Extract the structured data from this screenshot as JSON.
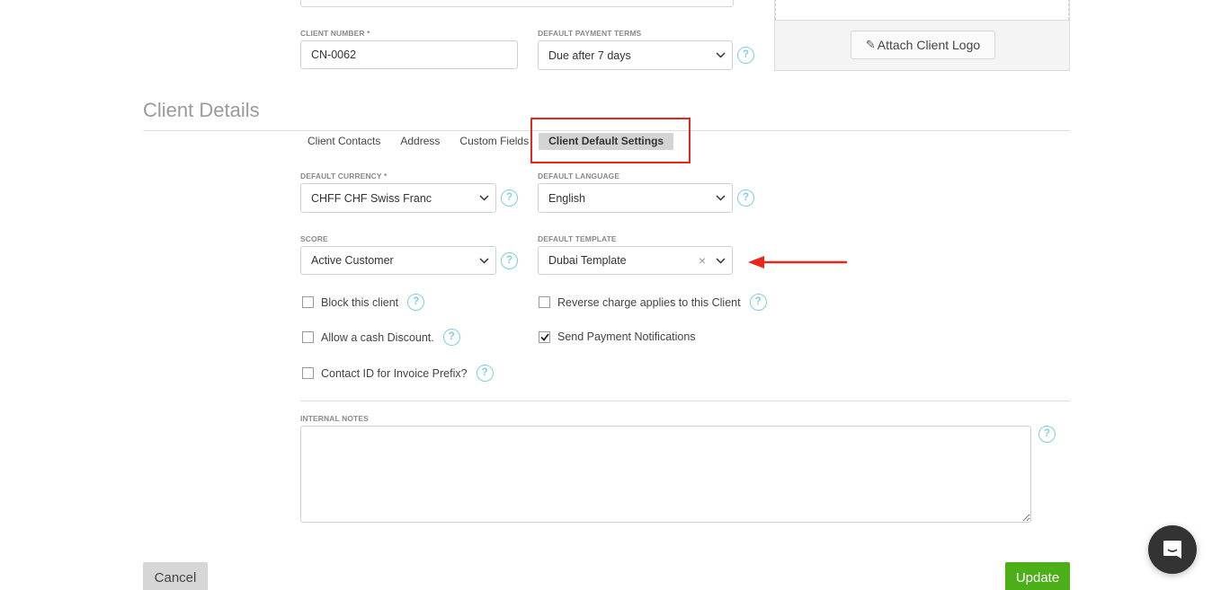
{
  "top_form": {
    "client_number": {
      "label": "CLIENT NUMBER *",
      "value": "CN-0062"
    },
    "payment_terms": {
      "label": "DEFAULT PAYMENT TERMS",
      "value": "Due after 7 days"
    },
    "attach_logo_label": "Attach Client Logo"
  },
  "section": {
    "title": "Client Details",
    "tabs": [
      {
        "label": "Client Contacts",
        "active": false
      },
      {
        "label": "Address",
        "active": false
      },
      {
        "label": "Custom Fields",
        "active": false
      },
      {
        "label": "Client Default Settings",
        "active": true
      }
    ]
  },
  "settings": {
    "currency": {
      "label": "DEFAULT CURRENCY *",
      "value": "CHFF CHF Swiss Franc"
    },
    "language": {
      "label": "DEFAULT LANGUAGE",
      "value": "English"
    },
    "score": {
      "label": "SCORE",
      "value": "Active Customer"
    },
    "template": {
      "label": "DEFAULT TEMPLATE",
      "value": "Dubai Template"
    },
    "checkboxes": {
      "block_client": {
        "label": "Block this client",
        "checked": false
      },
      "cash_discount": {
        "label": "Allow a cash Discount.",
        "checked": false
      },
      "contact_id_prefix": {
        "label": "Contact ID for Invoice Prefix?",
        "checked": false
      },
      "reverse_charge": {
        "label": "Reverse charge applies to this Client",
        "checked": false
      },
      "payment_notifications": {
        "label": "Send Payment Notifications",
        "checked": true
      }
    },
    "internal_notes": {
      "label": "INTERNAL NOTES",
      "value": ""
    }
  },
  "help_glyph": "?",
  "clear_glyph": "×",
  "clip_glyph": "✎",
  "actions": {
    "cancel": "Cancel",
    "update": "Update"
  },
  "annotation": {
    "color": "#e8261b"
  },
  "colors": {
    "update_green": "#4caf17",
    "help_blue": "#7fcde0"
  }
}
